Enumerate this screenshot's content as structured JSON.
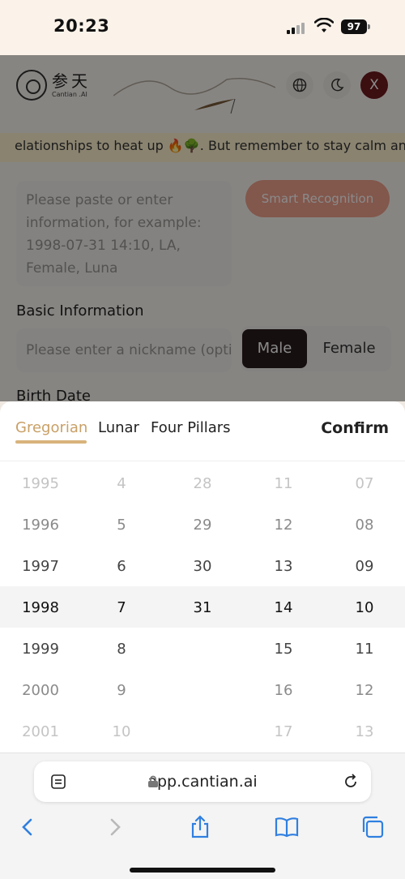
{
  "status_bar": {
    "time": "20:23",
    "battery": "97"
  },
  "app": {
    "logo_cn": "参天",
    "logo_en": "Cantian .AI",
    "avatar_letter": "X",
    "marquee": "elationships to heat up 🔥🌳. But remember to stay calm and",
    "paste_placeholder": "Please paste or enter information, for example: 1998-07-31 14:10, LA, Female, Luna",
    "smart_button": "Smart Recognition",
    "basic_info_label": "Basic Information",
    "nickname_placeholder": "Please enter a nickname (optional)",
    "gender": {
      "male": "Male",
      "female": "Female",
      "selected": "Male"
    },
    "birth_date_label": "Birth Date"
  },
  "picker": {
    "tabs": [
      {
        "label": "Gregorian",
        "active": true
      },
      {
        "label": "Lunar",
        "active": false
      },
      {
        "label": "Four Pillars",
        "active": false
      }
    ],
    "confirm_label": "Confirm",
    "columns": [
      [
        "1995",
        "1996",
        "1997",
        "1998",
        "1999",
        "2000",
        "2001"
      ],
      [
        "4",
        "5",
        "6",
        "7",
        "8",
        "9",
        "10"
      ],
      [
        "28",
        "29",
        "30",
        "31",
        "",
        "",
        ""
      ],
      [
        "11",
        "12",
        "13",
        "14",
        "15",
        "16",
        "17"
      ],
      [
        "07",
        "08",
        "09",
        "10",
        "11",
        "12",
        "13"
      ]
    ],
    "selected_index": 3
  },
  "browser": {
    "url": "app.cantian.ai"
  },
  "colors": {
    "accent": "#c9a066",
    "avatar": "#6e1a1f",
    "smart_button": "#f0a28c"
  }
}
